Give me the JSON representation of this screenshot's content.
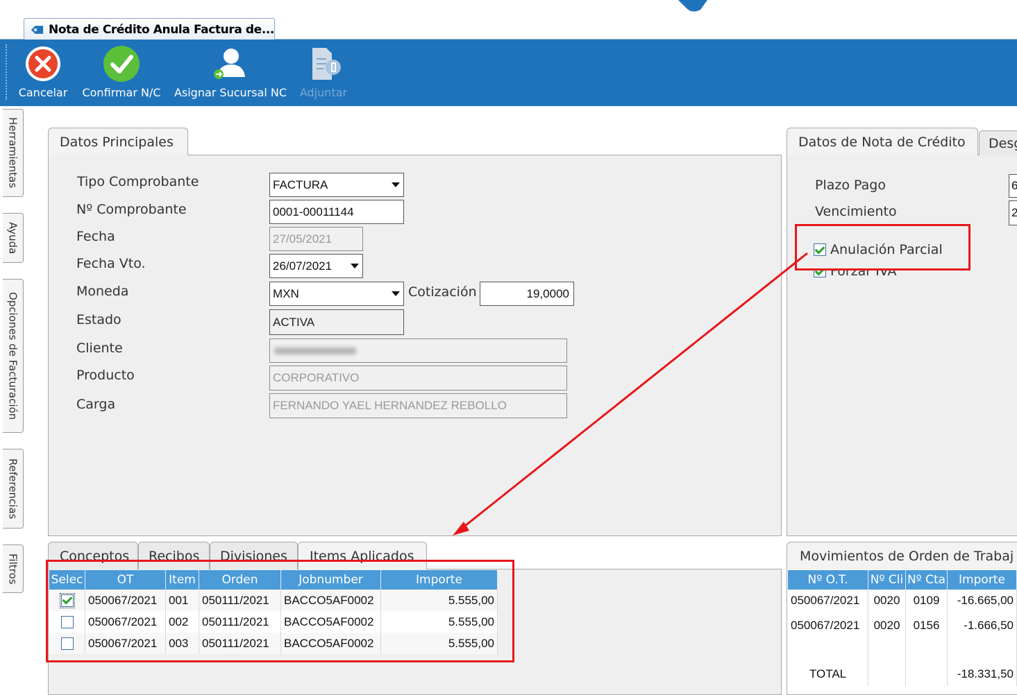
{
  "colors": {
    "ribbon": "#1f73bb",
    "grid_header": "#4a9bd8",
    "highlight": "#e8161a"
  },
  "doc_tab": {
    "title": "Nota de Crédito Anula Factura de...",
    "icon": "bookmark-icon"
  },
  "toolbar": {
    "cancel": {
      "label": "Cancelar",
      "icon": "cancel-x-icon"
    },
    "confirm": {
      "label": "Confirmar N/C",
      "icon": "check-icon"
    },
    "assign_branch": {
      "label": "Asignar Sucursal NC",
      "icon": "user-assign-icon"
    },
    "attach": {
      "label": "Adjuntar",
      "icon": "attachment-document-icon",
      "enabled": false
    }
  },
  "side_tabs": [
    "Herramientas",
    "Ayuda",
    "Opciones de Facturación",
    "Referencias",
    "Filtros"
  ],
  "main_panel": {
    "tab_label": "Datos Principales",
    "fields": {
      "tipo_comprobante": {
        "label": "Tipo Comprobante",
        "value": "FACTURA"
      },
      "nro_comprobante": {
        "label": "Nº Comprobante",
        "value": "0001-00011144"
      },
      "fecha": {
        "label": "Fecha",
        "value": "27/05/2021"
      },
      "fecha_vto": {
        "label": "Fecha Vto.",
        "value": "26/07/2021"
      },
      "moneda": {
        "label": "Moneda",
        "value": "MXN"
      },
      "cotizacion": {
        "label": "Cotización",
        "value": "19,0000"
      },
      "estado": {
        "label": "Estado",
        "value": "ACTIVA"
      },
      "cliente": {
        "label": "Cliente",
        "value": ""
      },
      "producto": {
        "label": "Producto",
        "value": "CORPORATIVO"
      },
      "carga": {
        "label": "Carga",
        "value": "FERNANDO YAEL HERNANDEZ REBOLLO"
      }
    }
  },
  "nc_panel": {
    "tab_label": "Datos de Nota de Crédito",
    "tab2_label": "Desg",
    "plazo_pago": {
      "label": "Plazo Pago",
      "value": "6"
    },
    "vencimiento": {
      "label": "Vencimiento",
      "value": "2"
    },
    "anulacion_parcial": {
      "label": "Anulación Parcial",
      "checked": true
    },
    "forzar_iva": {
      "label": "Forzar IVA",
      "checked": true
    }
  },
  "bottom_tabs": [
    "Conceptos",
    "Recibos",
    "Divisiones",
    "Items Aplicados"
  ],
  "items_grid": {
    "columns": [
      "Selec",
      "OT",
      "Item",
      "Orden",
      "Jobnumber",
      "Importe"
    ],
    "rows": [
      {
        "selected": true,
        "ot": "050067/2021",
        "item": "001",
        "orden": "050111/2021",
        "jobnumber": "BACCO5AF0002",
        "importe": "5.555,00"
      },
      {
        "selected": false,
        "ot": "050067/2021",
        "item": "002",
        "orden": "050111/2021",
        "jobnumber": "BACCO5AF0002",
        "importe": "5.555,00"
      },
      {
        "selected": false,
        "ot": "050067/2021",
        "item": "003",
        "orden": "050111/2021",
        "jobnumber": "BACCO5AF0002",
        "importe": "5.555,00"
      }
    ]
  },
  "movements_panel": {
    "tab_label": "Movimientos de Orden de Trabaj",
    "columns": [
      "Nº O.T.",
      "Nº Cli",
      "Nº Cta",
      "Importe"
    ],
    "rows": [
      {
        "ot": "050067/2021",
        "cli": "0020",
        "cta": "0109",
        "importe": "-16.665,00"
      },
      {
        "ot": "050067/2021",
        "cli": "0020",
        "cta": "0156",
        "importe": "-1.666,50"
      }
    ],
    "total_label": "TOTAL",
    "total_value": "-18.331,50"
  }
}
